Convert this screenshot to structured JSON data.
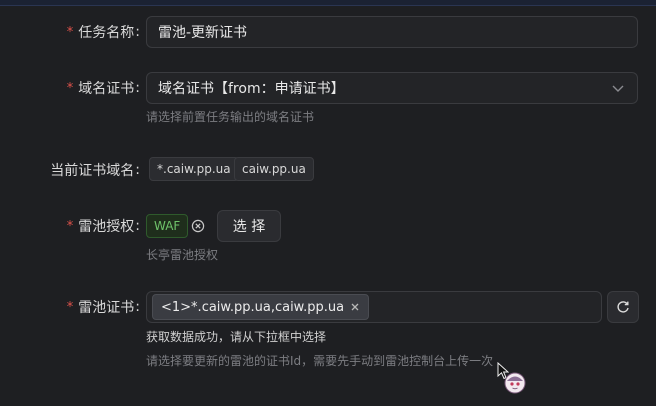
{
  "form": {
    "task_name": {
      "label": "任务名称",
      "value": "雷池-更新证书",
      "required": true
    },
    "domain_cert": {
      "label": "域名证书",
      "value": "域名证书【from：申请证书】",
      "help": "请选择前置任务输出的域名证书",
      "required": true
    },
    "current_domains": {
      "label": "当前证书域名",
      "tags": [
        "*.caiw.pp.ua",
        "caiw.pp.ua"
      ]
    },
    "safeline_auth": {
      "label": "雷池授权",
      "tag": "WAF",
      "button": "选 择",
      "help": "长亭雷池授权",
      "required": true
    },
    "safeline_cert": {
      "label": "雷池证书",
      "selected_tag": "<1>*.caiw.pp.ua,caiw.pp.ua",
      "success": "获取数据成功，请从下拉框中选择",
      "help": "请选择要更新的雷池的证书Id，需要先手动到雷池控制台上传一次",
      "required": true
    }
  },
  "colors": {
    "required": "#e0524b",
    "waf": "#6fc26a",
    "background": "#1e1f22"
  },
  "icons": [
    "chevron-down-icon",
    "close-circle-icon",
    "close-icon",
    "refresh-icon",
    "mouse-cursor-icon",
    "sticker-icon"
  ]
}
